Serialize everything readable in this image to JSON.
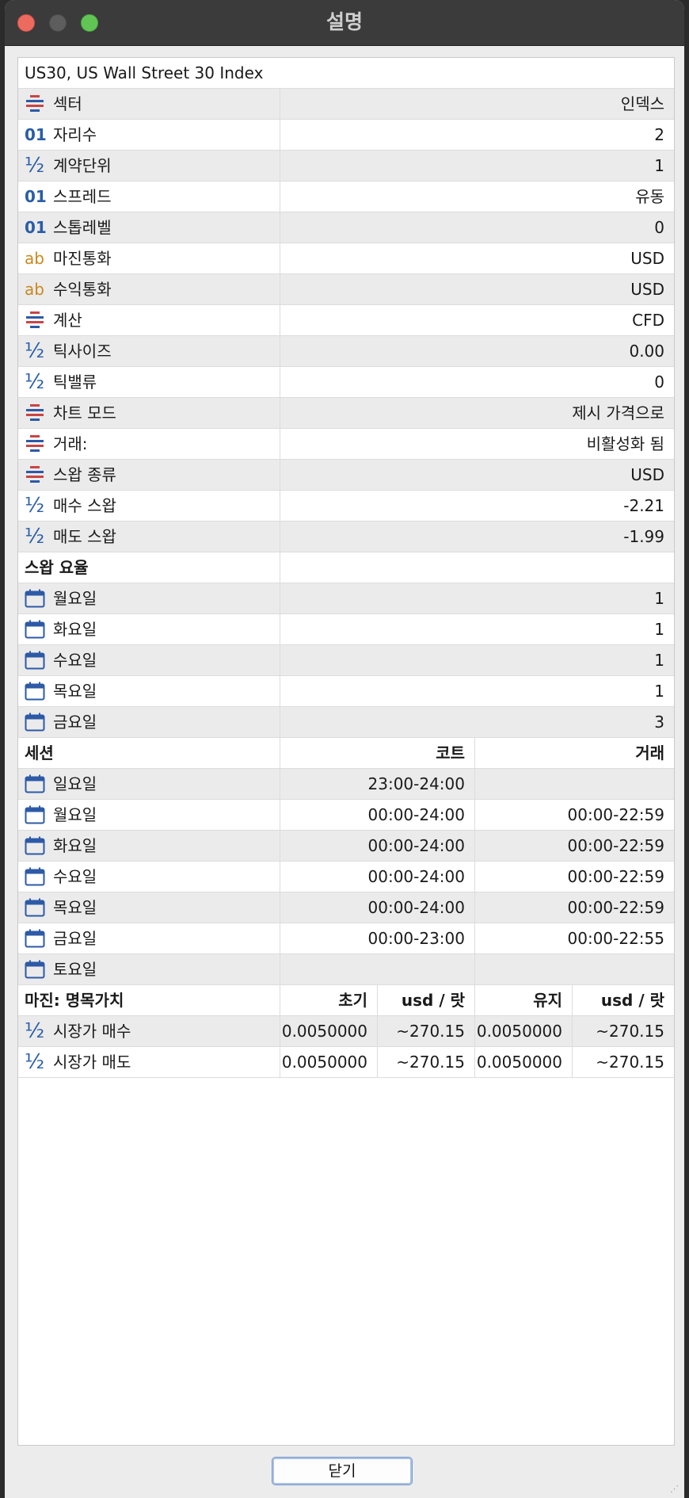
{
  "window": {
    "title": "설명"
  },
  "symbol_title": "US30, US Wall Street 30 Index",
  "properties": [
    {
      "icon": "list-icon",
      "name": "섹터",
      "value": "인덱스"
    },
    {
      "icon": "digits-icon",
      "name": "자리수",
      "value": "2"
    },
    {
      "icon": "fraction-icon",
      "name": "계약단위",
      "value": "1"
    },
    {
      "icon": "digits-icon",
      "name": "스프레드",
      "value": "유동"
    },
    {
      "icon": "digits-icon",
      "name": "스톱레벨",
      "value": "0"
    },
    {
      "icon": "text-icon",
      "name": "마진통화",
      "value": "USD"
    },
    {
      "icon": "text-icon",
      "name": "수익통화",
      "value": "USD"
    },
    {
      "icon": "list-icon",
      "name": "계산",
      "value": "CFD"
    },
    {
      "icon": "fraction-icon",
      "name": "틱사이즈",
      "value": "0.00"
    },
    {
      "icon": "fraction-icon",
      "name": "틱밸류",
      "value": "0"
    },
    {
      "icon": "list-icon",
      "name": "차트 모드",
      "value": "제시 가격으로"
    },
    {
      "icon": "list-icon",
      "name": "거래:",
      "value": "비활성화 됨"
    },
    {
      "icon": "list-icon",
      "name": "스왑 종류",
      "value": "USD"
    },
    {
      "icon": "fraction-icon",
      "name": "매수 스왑",
      "value": "-2.21"
    },
    {
      "icon": "fraction-icon",
      "name": "매도 스왑",
      "value": "-1.99"
    }
  ],
  "swap_rates": {
    "header": "스왑 요율",
    "rows": [
      {
        "icon": "calendar-icon",
        "name": "월요일",
        "value": "1"
      },
      {
        "icon": "calendar-icon",
        "name": "화요일",
        "value": "1"
      },
      {
        "icon": "calendar-icon",
        "name": "수요일",
        "value": "1"
      },
      {
        "icon": "calendar-icon",
        "name": "목요일",
        "value": "1"
      },
      {
        "icon": "calendar-icon",
        "name": "금요일",
        "value": "3"
      }
    ]
  },
  "sessions": {
    "header": "세션",
    "col_quote": "코트",
    "col_trade": "거래",
    "rows": [
      {
        "icon": "calendar-icon",
        "name": "일요일",
        "quote": "23:00-24:00",
        "trade": ""
      },
      {
        "icon": "calendar-icon",
        "name": "월요일",
        "quote": "00:00-24:00",
        "trade": "00:00-22:59"
      },
      {
        "icon": "calendar-icon",
        "name": "화요일",
        "quote": "00:00-24:00",
        "trade": "00:00-22:59"
      },
      {
        "icon": "calendar-icon",
        "name": "수요일",
        "quote": "00:00-24:00",
        "trade": "00:00-22:59"
      },
      {
        "icon": "calendar-icon",
        "name": "목요일",
        "quote": "00:00-24:00",
        "trade": "00:00-22:59"
      },
      {
        "icon": "calendar-icon",
        "name": "금요일",
        "quote": "00:00-23:00",
        "trade": "00:00-22:55"
      },
      {
        "icon": "calendar-icon",
        "name": "토요일",
        "quote": "",
        "trade": ""
      }
    ]
  },
  "margin": {
    "header": "마진: 명목가치",
    "col_initial": "초기",
    "col_initial_unit": "usd / 랏",
    "col_maint": "유지",
    "col_maint_unit": "usd / 랏",
    "rows": [
      {
        "icon": "fraction-icon",
        "name": "시장가 매수",
        "initial": "0.0050000",
        "initial_usd": "~270.15",
        "maint": "0.0050000",
        "maint_usd": "~270.15"
      },
      {
        "icon": "fraction-icon",
        "name": "시장가 매도",
        "initial": "0.0050000",
        "initial_usd": "~270.15",
        "maint": "0.0050000",
        "maint_usd": "~270.15"
      }
    ]
  },
  "close_button": "닫기",
  "icon_glyphs": {
    "digits": "01",
    "text": "ab",
    "fraction": "½"
  }
}
